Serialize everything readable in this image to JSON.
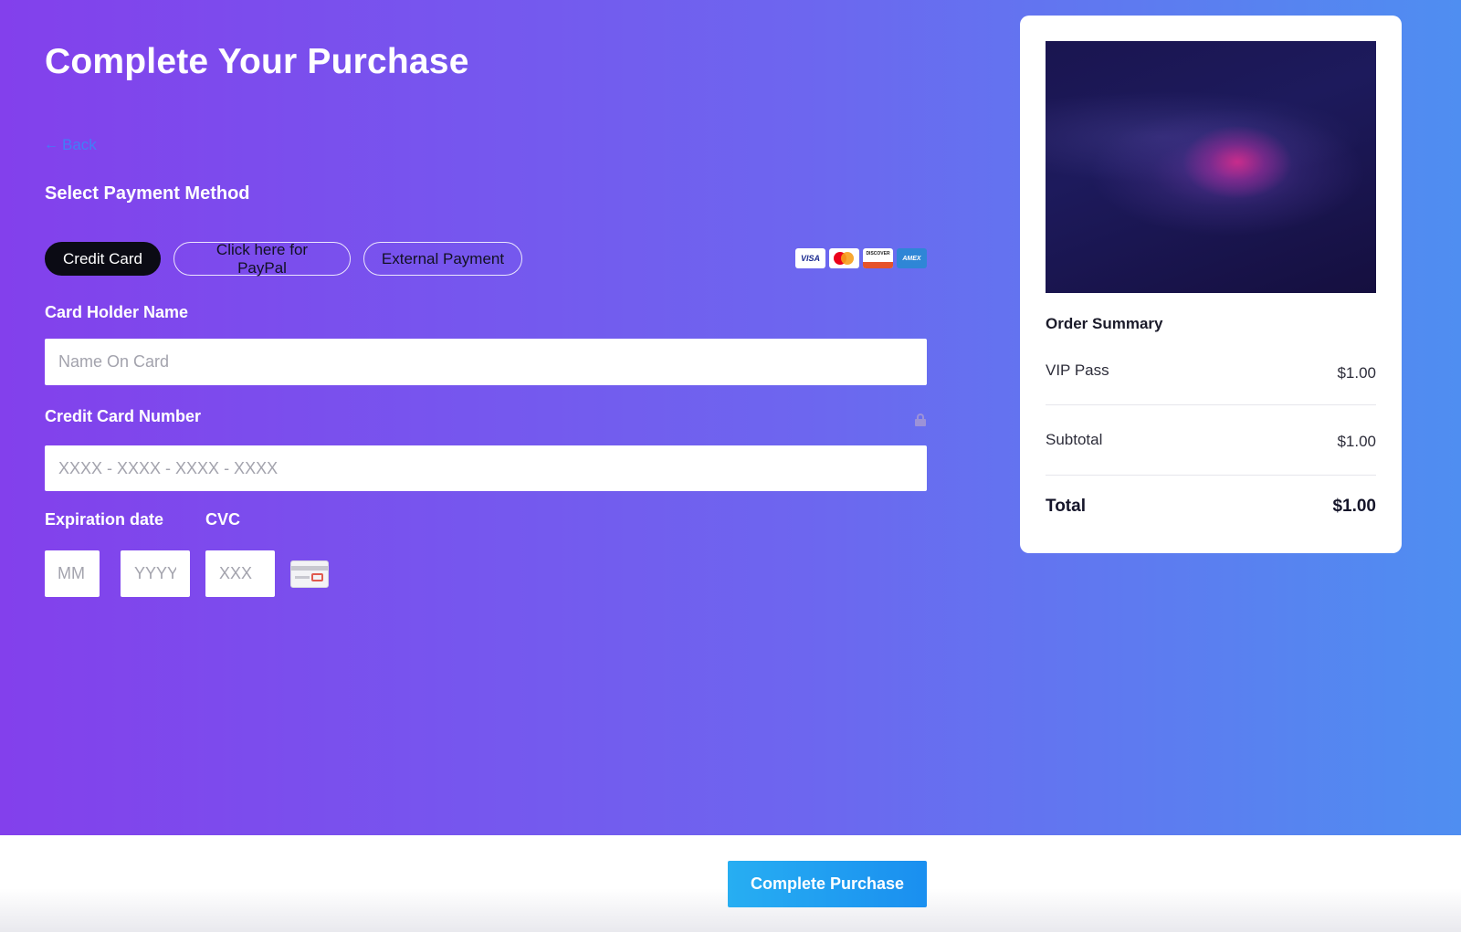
{
  "page": {
    "title": "Complete Your Purchase",
    "back_label": "Back",
    "back_arrow": "←"
  },
  "payment": {
    "section_title": "Select Payment Method",
    "tabs": [
      {
        "label": "Credit Card",
        "active": true
      },
      {
        "label": "Click here for PayPal",
        "active": false
      },
      {
        "label": "External Payment",
        "active": false
      }
    ],
    "card_brands": {
      "visa": "VISA",
      "discover": "DISCOVER",
      "amex": "AMEX",
      "mastercard_icon": "mastercard-icon"
    }
  },
  "form": {
    "holder_label": "Card Holder Name",
    "holder_placeholder": "Name On Card",
    "number_label": "Credit Card Number",
    "number_placeholder": "XXXX - XXXX - XXXX - XXXX",
    "expiration_label": "Expiration date",
    "month_placeholder": "MM",
    "year_placeholder": "YYYY",
    "cvc_label": "CVC",
    "cvc_placeholder": "XXX",
    "lock_icon": "lock-icon",
    "cvc_icon": "card-cvc-icon"
  },
  "summary": {
    "title": "Order Summary",
    "item_name": "VIP Pass",
    "item_price": "$1.00",
    "subtotal_label": "Subtotal",
    "subtotal_value": "$1.00",
    "total_label": "Total",
    "total_value": "$1.00"
  },
  "footer": {
    "complete_label": "Complete Purchase"
  },
  "colors": {
    "gradient_start": "#8340ec",
    "gradient_end": "#4f8ef1",
    "active_tab": "#0b0b14",
    "primary_button": "#1a8ff0",
    "link": "#3f7ff7"
  }
}
